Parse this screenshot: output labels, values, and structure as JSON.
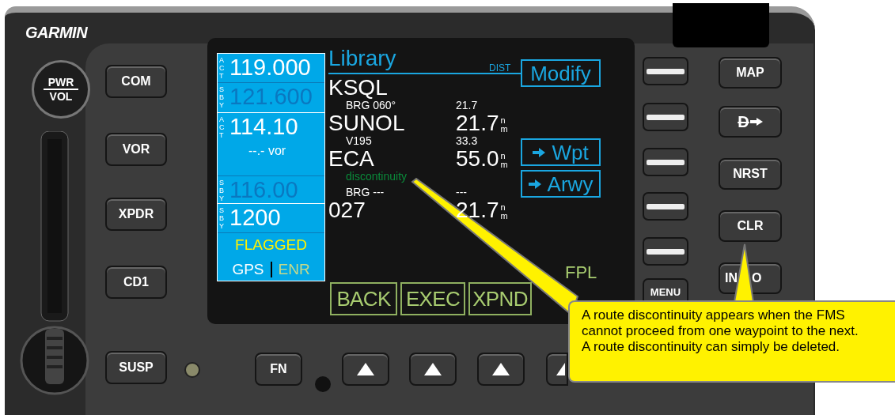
{
  "brand": "GARMIN",
  "power_knob": {
    "top": "PWR",
    "bottom": "VOL"
  },
  "left_keys": [
    "COM",
    "VOR",
    "XPDR",
    "CD1",
    "SUSP"
  ],
  "bottom_keys": [
    {
      "kind": "text",
      "label": "FN"
    },
    {
      "kind": "arrow"
    },
    {
      "kind": "arrow"
    },
    {
      "kind": "arrow"
    },
    {
      "kind": "arrow"
    }
  ],
  "menu_key": "MENU",
  "right_keys": [
    {
      "kind": "text",
      "label": "MAP"
    },
    {
      "kind": "direct",
      "label": "D"
    },
    {
      "kind": "text",
      "label": "NRST"
    },
    {
      "kind": "text",
      "label": "CLR"
    },
    {
      "kind": "covered",
      "parts": [
        "IN",
        "O"
      ]
    }
  ],
  "screen": {
    "radios": [
      {
        "tag": "ACT",
        "value": "119.000",
        "dimmed": false
      },
      {
        "tag": "SBY",
        "value": "121.600",
        "dimmed": true
      },
      {
        "tag": "ACT",
        "value": "114.10",
        "sub": "--.- vor",
        "dimmed": false
      },
      {
        "tag": "SBY",
        "value": "116.00",
        "dimmed": true
      },
      {
        "tag": "SBY",
        "value": "1200",
        "dimmed": false
      }
    ],
    "status": "FLAGGED",
    "nav_source": "GPS",
    "phase": "ENR",
    "title": "Library",
    "column": "DIST",
    "rows": [
      {
        "kind": "waypoint",
        "name": "KSQL"
      },
      {
        "kind": "leg",
        "label": "BRG 060°",
        "distance": "21.7"
      },
      {
        "kind": "waypoint",
        "name": "SUNOL",
        "distance": "21.7",
        "unit_top": "n",
        "unit_bottom": "m"
      },
      {
        "kind": "leg",
        "label": "V195",
        "distance": "33.3"
      },
      {
        "kind": "waypoint",
        "name": "ECA",
        "distance": "55.0",
        "unit_top": "n",
        "unit_bottom": "m"
      },
      {
        "kind": "discontinuity",
        "label": "discontinuity"
      },
      {
        "kind": "leg",
        "label": "BRG ---",
        "distance": "---"
      },
      {
        "kind": "waypoint",
        "name": "027",
        "distance": "21.7",
        "unit_top": "n",
        "unit_bottom": "m"
      }
    ],
    "side_buttons": [
      {
        "label": "Modify",
        "arrow": false
      },
      {
        "label": "Wpt",
        "arrow": true
      },
      {
        "label": "Arwy",
        "arrow": true
      }
    ],
    "soft_keys": [
      "BACK",
      "EXEC",
      "XPND"
    ],
    "page_name": "FPL"
  },
  "callout": "A route discontinuity appears when the FMS cannot proceed from one waypoint to the next. A route discontinuity can simply be deleted."
}
